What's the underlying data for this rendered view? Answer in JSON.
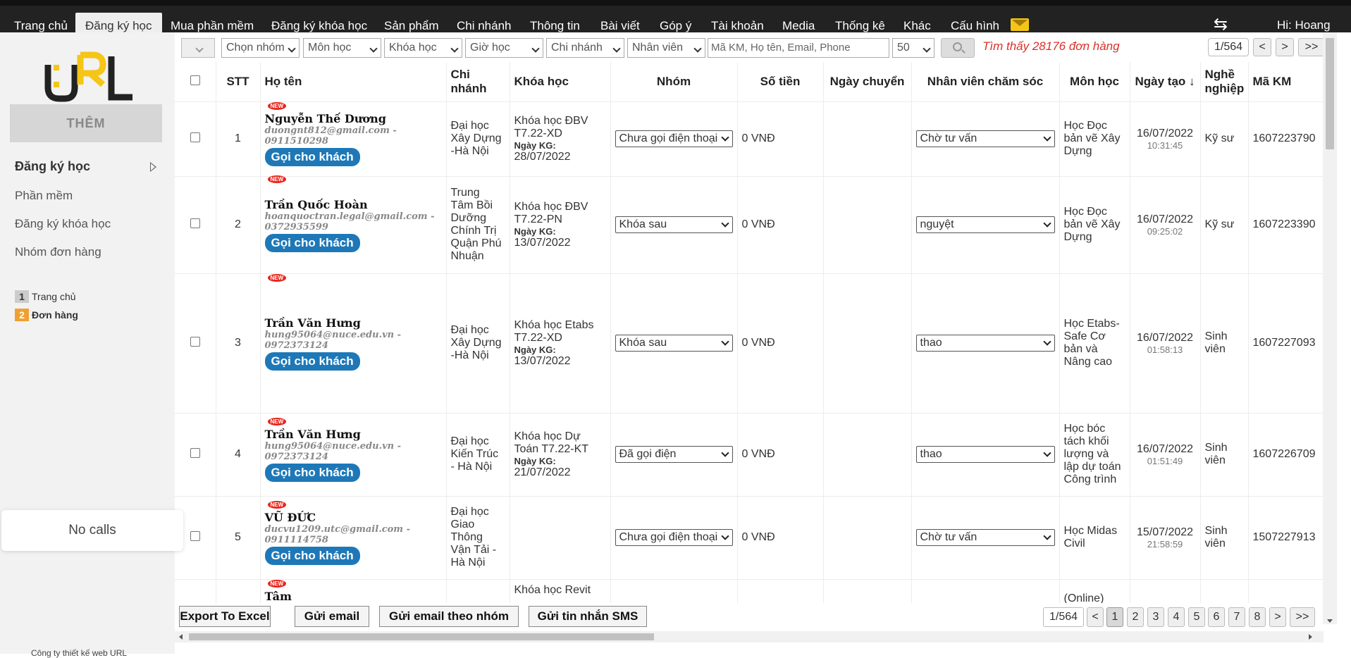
{
  "nav": {
    "items": [
      "Trang chủ",
      "Đăng ký học",
      "Mua phần mềm",
      "Đăng ký khóa học",
      "Sản phẩm",
      "Chi nhánh",
      "Thông tin",
      "Bài viết",
      "Góp ý",
      "Tài khoản",
      "Media",
      "Thống kê",
      "Khác",
      "Cấu hình"
    ],
    "active_index": 1,
    "mail_icon": "mail-icon",
    "refresh_icon": "refresh-icon",
    "greeting": "Hi: Hoang"
  },
  "sidebar": {
    "logo_text": "URL",
    "add_button": "THÊM",
    "main_item": "Đăng ký học",
    "links": [
      "Phần mềm",
      "Đăng ký khóa học",
      "Nhóm đơn hàng"
    ],
    "breadcrumbs": [
      {
        "num": "1",
        "label": "Trang chủ"
      },
      {
        "num": "2",
        "label": "Đơn hàng"
      }
    ],
    "no_calls": "No calls",
    "footer": "Công ty thiết kế web URL"
  },
  "filters": {
    "group": "Chọn nhóm",
    "subject": "Môn học",
    "course": "Khóa học",
    "hour": "Giờ học",
    "branch": "Chi nhánh",
    "staff": "Nhân viên",
    "search_placeholder": "Mã KM, Họ tên, Email, Phone",
    "per_page": "50",
    "found_text": "Tìm thấy 28176 đơn hàng",
    "page": "1/564",
    "prev": "<",
    "next": ">",
    "last": ">>"
  },
  "table": {
    "headers": {
      "stt": "STT",
      "name": "Họ tên",
      "branch": "Chi nhánh",
      "course": "Khóa học",
      "group": "Nhóm",
      "amount": "Số tiền",
      "transfer_date": "Ngày chuyển",
      "staff": "Nhân viên chăm sóc",
      "subject": "Môn học",
      "created": "Ngày tạo ↓",
      "job": "Nghề nghiệp",
      "promo": "Mã KM"
    },
    "call_label": "Gọi cho khách",
    "new_label": "NEW",
    "kg_label": "Ngày KG:",
    "rows": [
      {
        "stt": "1",
        "name": "Nguyễn Thế Dương",
        "email": "duongnt812@gmail.com -",
        "phone": "0911510298",
        "branch": "Đại học Xây Dựng -Hà Nội",
        "course": "Khóa học ĐBV T7.22-XD",
        "kg_date": "28/07/2022",
        "group": "Chưa gọi điện thoại",
        "amount": "0 VNĐ",
        "transfer": "",
        "staff": "Chờ tư vấn",
        "subject": "Học Đọc bản vẽ Xây Dựng",
        "date": "16/07/2022",
        "time": "10:31:45",
        "job": "Kỹ sư",
        "promo": "1607223790"
      },
      {
        "stt": "2",
        "name": "Trần Quốc Hoàn",
        "email": "hoanquoctran.legal@gmail.com -",
        "phone": "0372935599",
        "branch": "Trung Tâm Bồi Dưỡng Chính Trị Quận Phú Nhuận",
        "course": "Khóa học ĐBV T7.22-PN",
        "kg_date": "13/07/2022",
        "group": "Khóa sau",
        "amount": "0 VNĐ",
        "transfer": "",
        "staff": "nguyệt",
        "subject": "Học Đọc bản vẽ Xây Dựng",
        "date": "16/07/2022",
        "time": "09:25:02",
        "job": "Kỹ sư",
        "promo": "1607223390"
      },
      {
        "stt": "3",
        "name": "Trần Văn Hưng",
        "email": "hung95064@nuce.edu.vn -",
        "phone": "0972373124",
        "branch": "Đại học Xây Dựng -Hà Nội",
        "course": "Khóa học Etabs T7.22-XD",
        "kg_date": "13/07/2022",
        "group": "Khóa sau",
        "amount": "0 VNĐ",
        "transfer": "",
        "staff": "thao",
        "subject": "Học Etabs-Safe Cơ bản và Nâng cao",
        "date": "16/07/2022",
        "time": "01:58:13",
        "job": "Sinh viên",
        "promo": "1607227093"
      },
      {
        "stt": "4",
        "name": "Trần Văn Hưng",
        "email": "hung95064@nuce.edu.vn -",
        "phone": "0972373124",
        "branch": "Đại học Kiến Trúc - Hà Nội",
        "course": "Khóa học Dự Toán T7.22-KT",
        "kg_date": "21/07/2022",
        "group": "Đã gọi điện",
        "amount": "0 VNĐ",
        "transfer": "",
        "staff": "thao",
        "subject": "Học bóc tách khối lượng và lập dự toán Công trình",
        "date": "16/07/2022",
        "time": "01:51:49",
        "job": "Sinh viên",
        "promo": "1607226709"
      },
      {
        "stt": "5",
        "name": "VŨ ĐỨC",
        "email": "ducvu1209.utc@gmail.com -",
        "phone": "0911114758",
        "branch": "Đại học Giao Thông Vận Tải - Hà Nội",
        "course": "",
        "kg_date": "",
        "group": "Chưa gọi điện thoại",
        "amount": "0 VNĐ",
        "transfer": "",
        "staff": "Chờ tư vấn",
        "subject": "Học Midas Civil",
        "date": "15/07/2022",
        "time": "21:58:59",
        "job": "Sinh viên",
        "promo": "1507227913"
      },
      {
        "stt": "",
        "name": "Tâm",
        "email": "",
        "phone": "",
        "branch": "",
        "course": "Khóa học Revit",
        "kg_date": "",
        "group": "",
        "amount": "",
        "transfer": "",
        "staff": "",
        "subject": "(Online)",
        "date": "",
        "time": "",
        "job": "",
        "promo": ""
      }
    ]
  },
  "bottom": {
    "export": "Export To Excel",
    "email": "Gửi email",
    "email_group": "Gửi email theo nhóm",
    "sms": "Gửi tin nhắn SMS",
    "page": "1/564",
    "prev": "<",
    "pages": [
      "1",
      "2",
      "3",
      "4",
      "5",
      "6",
      "7",
      "8"
    ],
    "next": ">",
    "last": ">>"
  },
  "colors": {
    "nav_bg": "#222222",
    "call_btn": "#1e78b8",
    "found_text": "#d9302a",
    "logo_yellow": "#f5c518"
  }
}
